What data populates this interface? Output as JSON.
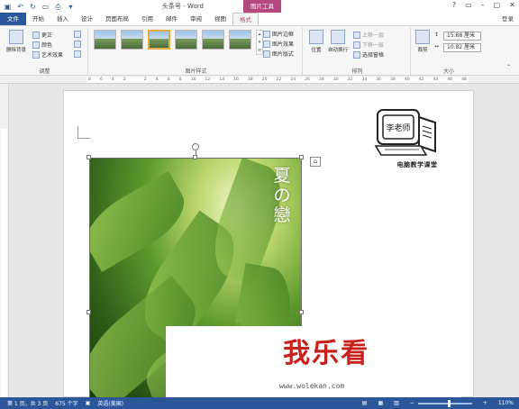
{
  "window": {
    "title": "头条号 - Word",
    "context_tab": "图片工具",
    "controls": [
      "?",
      "▭",
      "–",
      "▢",
      "✕"
    ]
  },
  "qat": [
    "save",
    "undo",
    "redo",
    "new",
    "print"
  ],
  "tabs": [
    {
      "label": "文件",
      "kind": "file"
    },
    {
      "label": "开始"
    },
    {
      "label": "插入"
    },
    {
      "label": "设计"
    },
    {
      "label": "页面布局"
    },
    {
      "label": "引用"
    },
    {
      "label": "邮件"
    },
    {
      "label": "审阅"
    },
    {
      "label": "视图"
    },
    {
      "label": "格式",
      "kind": "active"
    }
  ],
  "login": "登录",
  "ribbon": {
    "remove_bg": "删除背景",
    "corrections": "更正",
    "color": "颜色",
    "artistic": "艺术效果",
    "adjust_label": "调整",
    "styles_label": "图片样式",
    "border": "图片边框",
    "effects": "图片效果",
    "layout": "图片版式",
    "position": "位置",
    "wrap": "自动换行",
    "forward": "上移一层",
    "backward": "下移一层",
    "selection_pane": "选择窗格",
    "arrange_label": "排列",
    "crop": "裁剪",
    "height": "15.88 厘米",
    "width": "10.82 厘米",
    "size_label": "大小"
  },
  "ruler_ticks": [
    "8",
    "6",
    "4",
    "2",
    "",
    "2",
    "4",
    "6",
    "8",
    "10",
    "12",
    "14",
    "16",
    "18",
    "20",
    "22",
    "24",
    "26",
    "28",
    "30",
    "32",
    "34",
    "36",
    "38",
    "40",
    "42",
    "44",
    "46",
    "48"
  ],
  "document": {
    "photo_title": "夏の戀",
    "logo_caption": "电脑教学课堂",
    "logo_screen_text": "李老师"
  },
  "watermark": {
    "text": "我乐看",
    "url": "www.wolekan.com"
  },
  "status": {
    "page": "第 1 页，共 3 页",
    "words": "675 个字",
    "lang": "英语(美国)",
    "zoom": "110%"
  },
  "colors": {
    "accent": "#2b579a",
    "context": "#b5487f",
    "watermark": "#c8201a"
  }
}
